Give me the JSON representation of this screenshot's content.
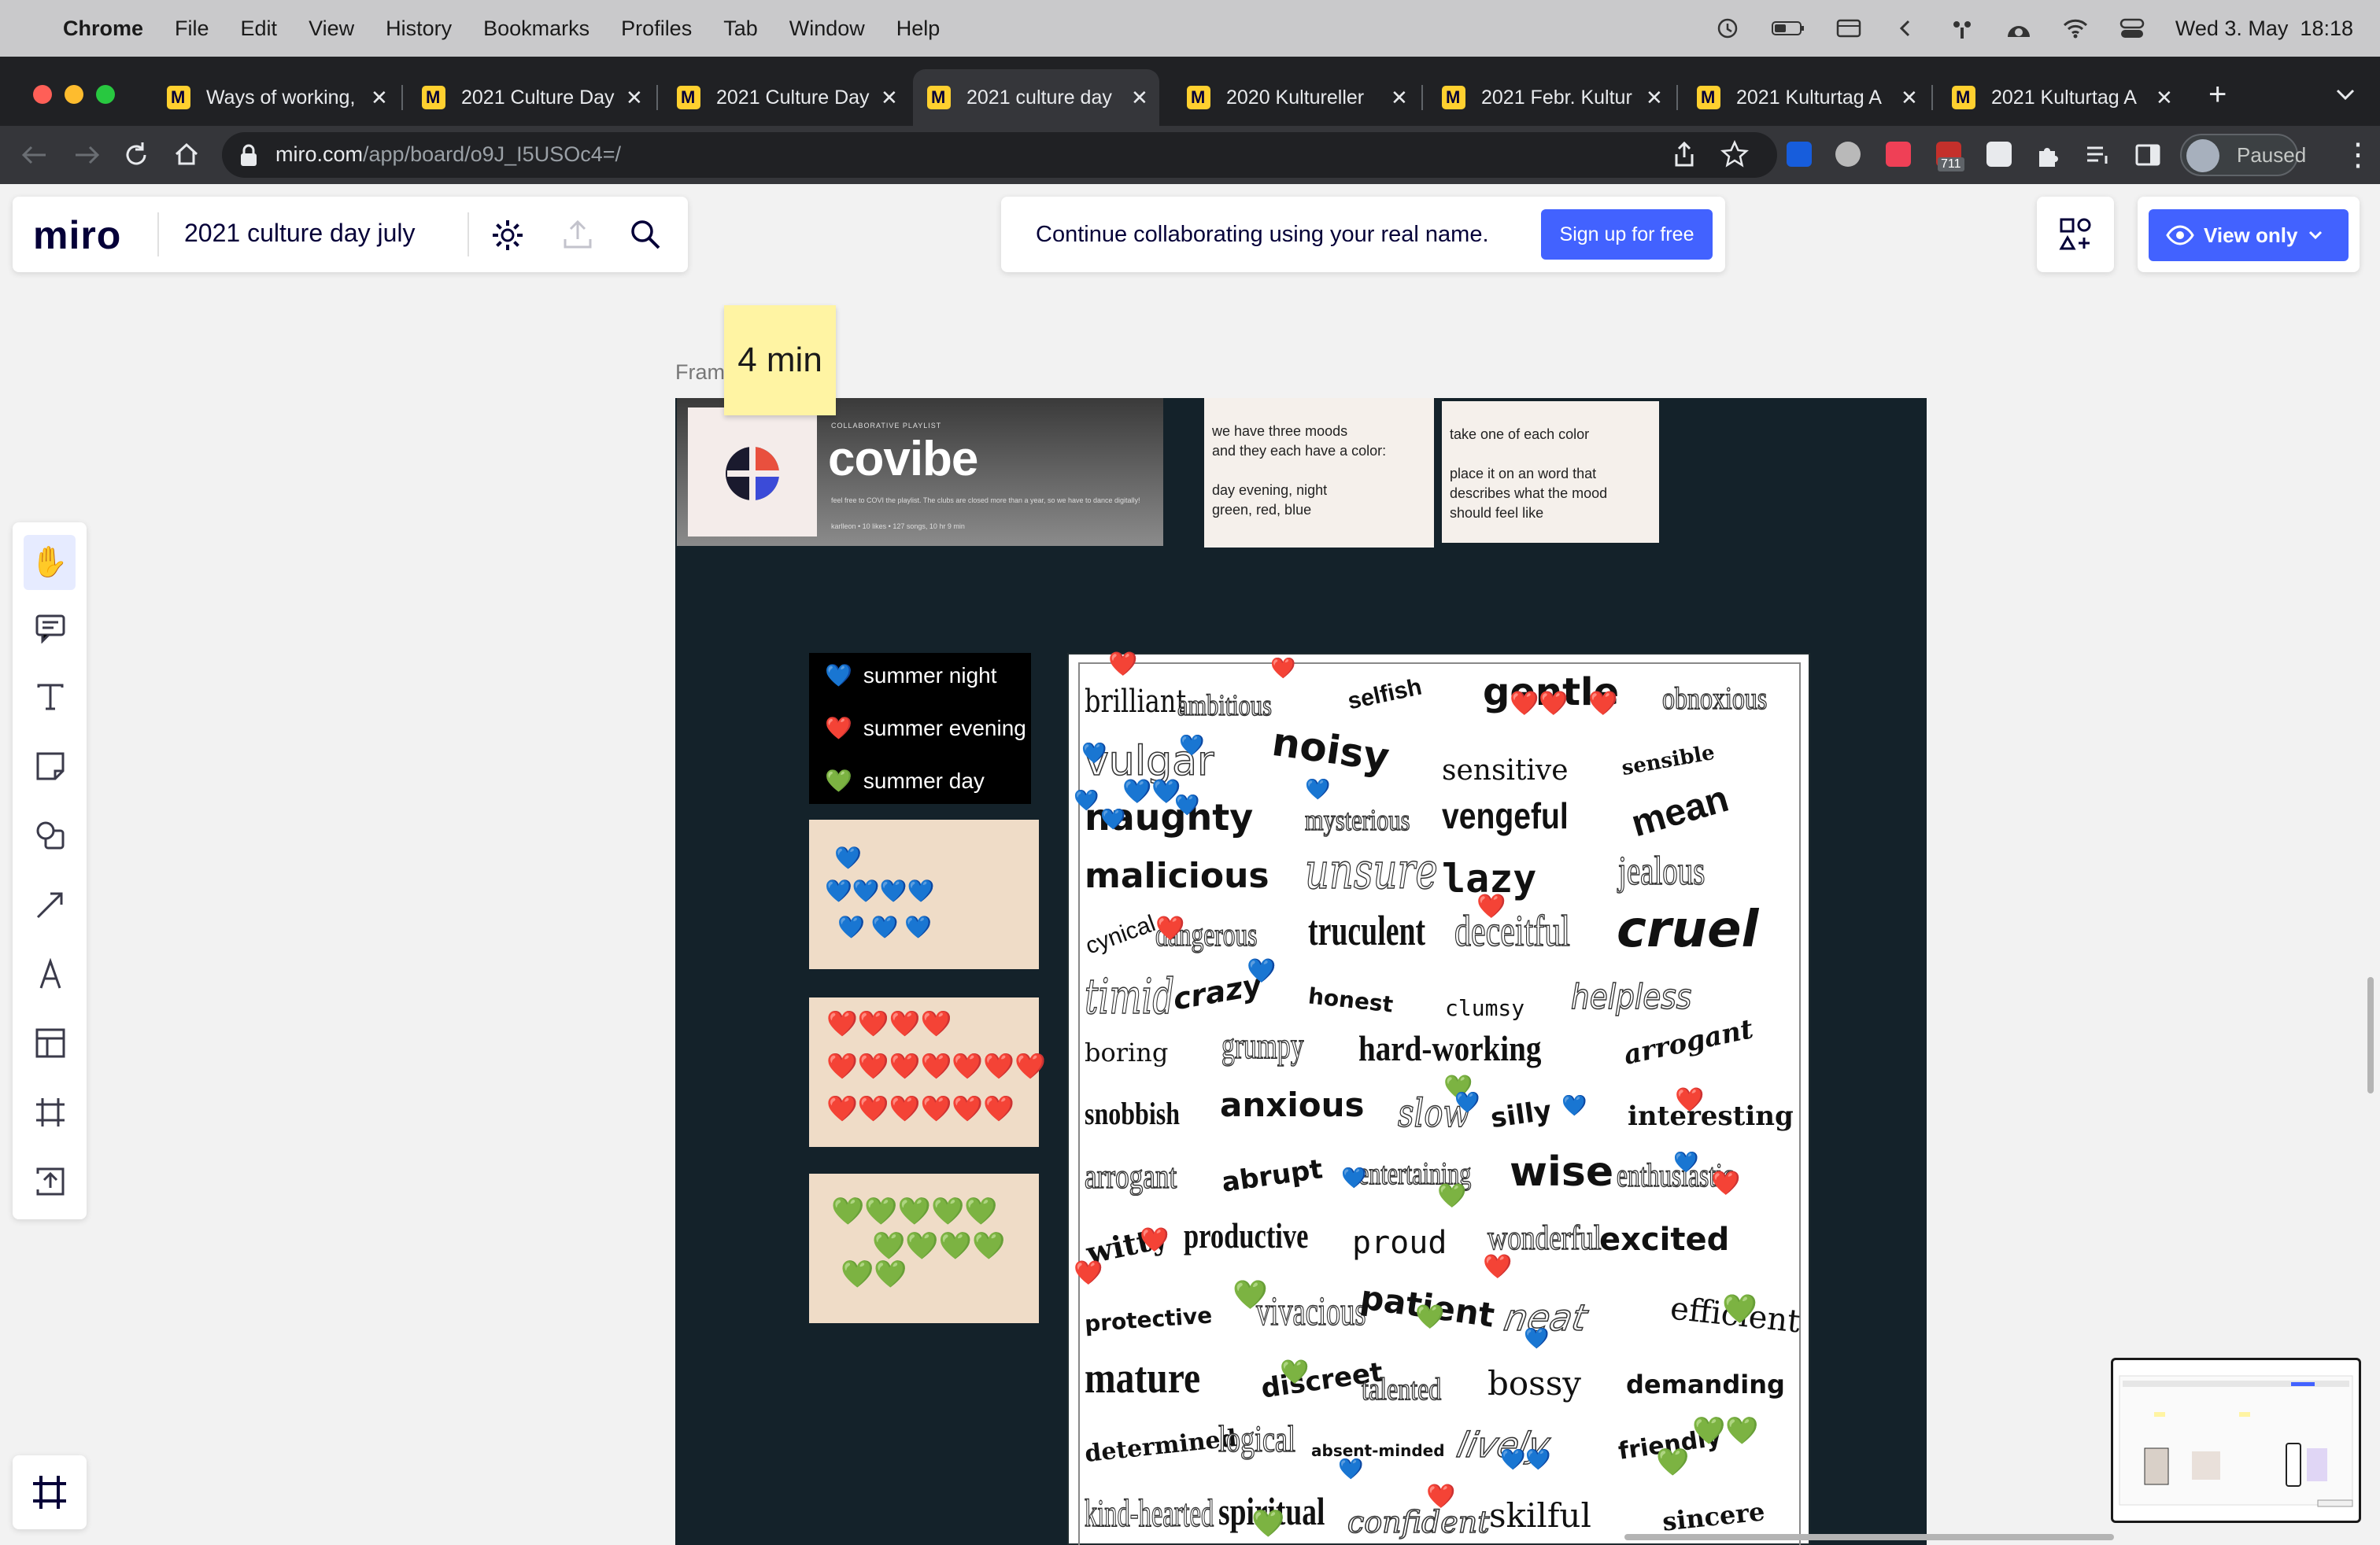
{
  "menubar": {
    "app": "Chrome",
    "items": [
      "File",
      "Edit",
      "View",
      "History",
      "Bookmarks",
      "Profiles",
      "Tab",
      "Window",
      "Help"
    ],
    "datetime": "Wed 3. May  18:18"
  },
  "browser": {
    "tabs": [
      {
        "title": "Ways of working,"
      },
      {
        "title": "2021 Culture Day"
      },
      {
        "title": "2021 Culture Day"
      },
      {
        "title": "2021 culture day"
      },
      {
        "title": "2020 Kultureller"
      },
      {
        "title": "2021 Febr. Kultur"
      },
      {
        "title": "2021 Kulturtag A"
      },
      {
        "title": "2021 Kulturtag A"
      }
    ],
    "active_tab_index": 3,
    "url_host": "miro.com",
    "url_path": "/app/board/o9J_I5USOc4=/",
    "ext_badge": "711",
    "profile_label": "Paused"
  },
  "miro": {
    "logo": "miro",
    "board_name": "2021 culture day july",
    "banner_text": "Continue collaborating using your real name.",
    "signup_label": "Sign up for free",
    "view_only_label": "View only",
    "frame_label": "Frame 19",
    "sticky_timer": "4 min"
  },
  "covibe": {
    "eyebrow": "COLLABORATIVE PLAYLIST",
    "name": "covibe",
    "description": "feel free to COVI the playlist. The clubs are closed more than a year, so we have to dance digitally!",
    "meta": "karlleon • 10 likes • 127 songs, 10 hr 9 min"
  },
  "notes": {
    "moods": "we have three moods\nand they each have a color:\n\nday evening, night\ngreen, red, blue",
    "instructions": "take one of each color\n\nplace it on an word that\ndescribes what the mood\nshould feel like"
  },
  "legend": [
    {
      "emoji": "💙",
      "label": "summer night"
    },
    {
      "emoji": "❤️",
      "label": "summer evening"
    },
    {
      "emoji": "💚",
      "label": "summer day"
    }
  ],
  "heart_boxes": {
    "blue": [
      "💙",
      "💙💙💙💙",
      "💙 💙 💙"
    ],
    "red": [
      "❤️❤️❤️❤️",
      "❤️❤️❤️❤️❤️❤️❤️",
      "❤️❤️❤️❤️❤️❤️"
    ],
    "green": [
      "💚💚💚💚💚",
      "💚💚💚💚",
      "💚💚"
    ]
  },
  "words": [
    "brilliant",
    "ambitious",
    "selfish",
    "gentle",
    "obnoxious",
    "vulgar",
    "noisy",
    "sensitive",
    "sensible",
    "naughty",
    "mysterious",
    "vengeful",
    "mean",
    "malicious",
    "unsure",
    "lazy",
    "jealous",
    "cynical",
    "dangerous",
    "truculent",
    "deceitful",
    "cruel",
    "timid",
    "crazy",
    "honest",
    "clumsy",
    "helpless",
    "boring",
    "grumpy",
    "hard-working",
    "arrogant",
    "snobbish",
    "anxious",
    "slow",
    "silly",
    "interesting",
    "arrogant",
    "abrupt",
    "entertaining",
    "wise",
    "enthusiastic",
    "witty",
    "productive",
    "proud",
    "wonderful",
    "excited",
    "protective",
    "vivacious",
    "patient",
    "neat",
    "efficient",
    "mature",
    "discreet",
    "talented",
    "bossy",
    "demanding",
    "determined",
    "logical",
    "absent-minded",
    "lively",
    "friendly",
    "kind-hearted",
    "spiritual",
    "confident",
    "skilful",
    "sincere"
  ],
  "colors": {
    "miro_blue": "#4262ff",
    "frame_bg": "#14222a",
    "sticky_yellow": "#fff4a3",
    "heartbox_bg": "#efdcc7"
  }
}
